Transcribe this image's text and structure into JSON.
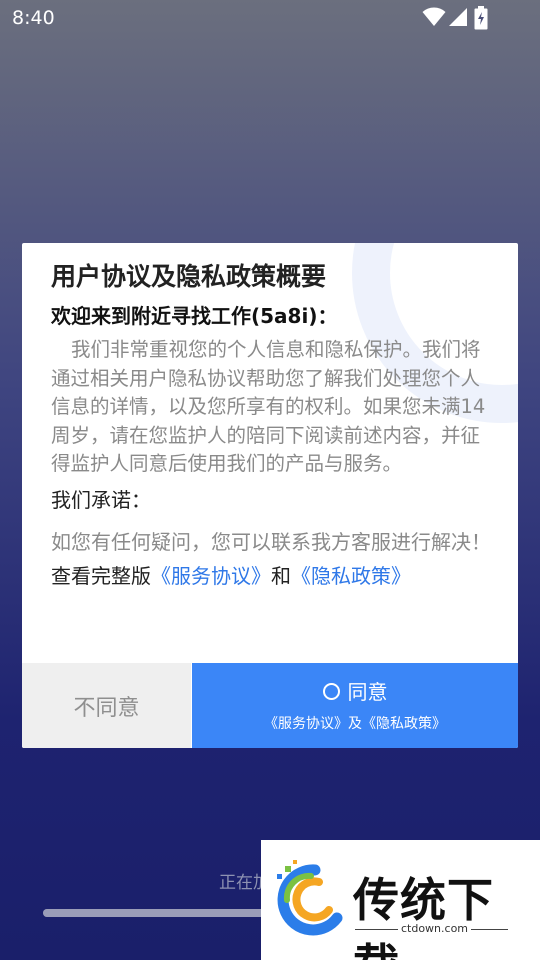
{
  "status_bar": {
    "time": "8:40",
    "icons": [
      "wifi-icon",
      "signal-icon",
      "battery-charging-icon"
    ]
  },
  "dialog": {
    "title": "用户协议及隐私政策概要",
    "welcome": "欢迎来到附近寻找工作(5a8i)：",
    "body": "我们非常重视您的个人信息和隐私保护。我们将通过相关用户隐私协议帮助您了解我们处理您个人信息的详情，以及您所享有的权利。如果您未满14周岁，请在您监护人的陪同下阅读前述内容，并征得监护人同意后使用我们的产品与服务。",
    "promise_label": "我们承诺：",
    "contact_text": "如您有任何疑问，您可以联系我方客服进行解决！",
    "view_prefix": "查看完整版",
    "service_link": "《服务协议》",
    "and_text": "和",
    "privacy_link": "《隐私政策》"
  },
  "buttons": {
    "disagree": "不同意",
    "agree": "同意",
    "agree_sub": "《服务协议》及《隐私政策》"
  },
  "loading": {
    "text": "正在加",
    "progress": 0.5
  },
  "watermark": {
    "name": "传统下载",
    "url": "ctdown.com"
  },
  "colors": {
    "accent": "#3b86f7",
    "link": "#2f78e8",
    "background_top": "#6b6f7e",
    "background_bottom": "#1a1f6a"
  }
}
